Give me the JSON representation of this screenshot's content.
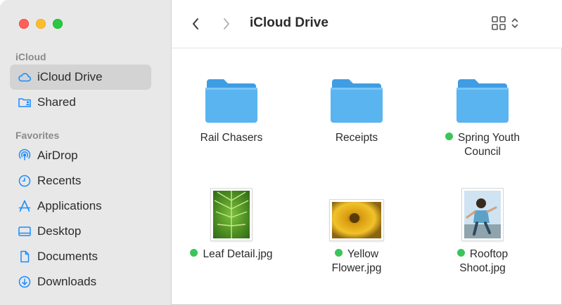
{
  "sidebar": {
    "sections": [
      {
        "title": "iCloud",
        "items": [
          {
            "label": "iCloud Drive",
            "icon": "cloud-icon",
            "selected": true
          },
          {
            "label": "Shared",
            "icon": "shared-folder-icon"
          }
        ]
      },
      {
        "title": "Favorites",
        "items": [
          {
            "label": "AirDrop",
            "icon": "airdrop-icon"
          },
          {
            "label": "Recents",
            "icon": "clock-icon"
          },
          {
            "label": "Applications",
            "icon": "applications-icon"
          },
          {
            "label": "Desktop",
            "icon": "desktop-icon"
          },
          {
            "label": "Documents",
            "icon": "document-icon"
          },
          {
            "label": "Downloads",
            "icon": "download-icon"
          }
        ]
      }
    ]
  },
  "toolbar": {
    "title": "iCloud Drive"
  },
  "files": [
    {
      "name": "Rail Chasers",
      "kind": "folder",
      "tag": false
    },
    {
      "name": "Receipts",
      "kind": "folder",
      "tag": false
    },
    {
      "name": "Spring Youth Council",
      "line1": "Spring Youth",
      "line2": "Council",
      "kind": "folder",
      "tag": true
    },
    {
      "name": "Leaf Detail.jpg",
      "kind": "image",
      "tag": true
    },
    {
      "name": "Yellow Flower.jpg",
      "line1": "Yellow",
      "line2": "Flower.jpg",
      "kind": "image",
      "tag": true
    },
    {
      "name": "Rooftop Shoot.jpg",
      "line1": "Rooftop",
      "line2": "Shoot.jpg",
      "kind": "image",
      "tag": true
    }
  ],
  "colors": {
    "folder": "#5ab4f0",
    "folder_tab": "#3f9de3",
    "accent": "#1a8cff",
    "tag_green": "#3cc45a",
    "sidebar_bg": "#e8e8e8"
  }
}
